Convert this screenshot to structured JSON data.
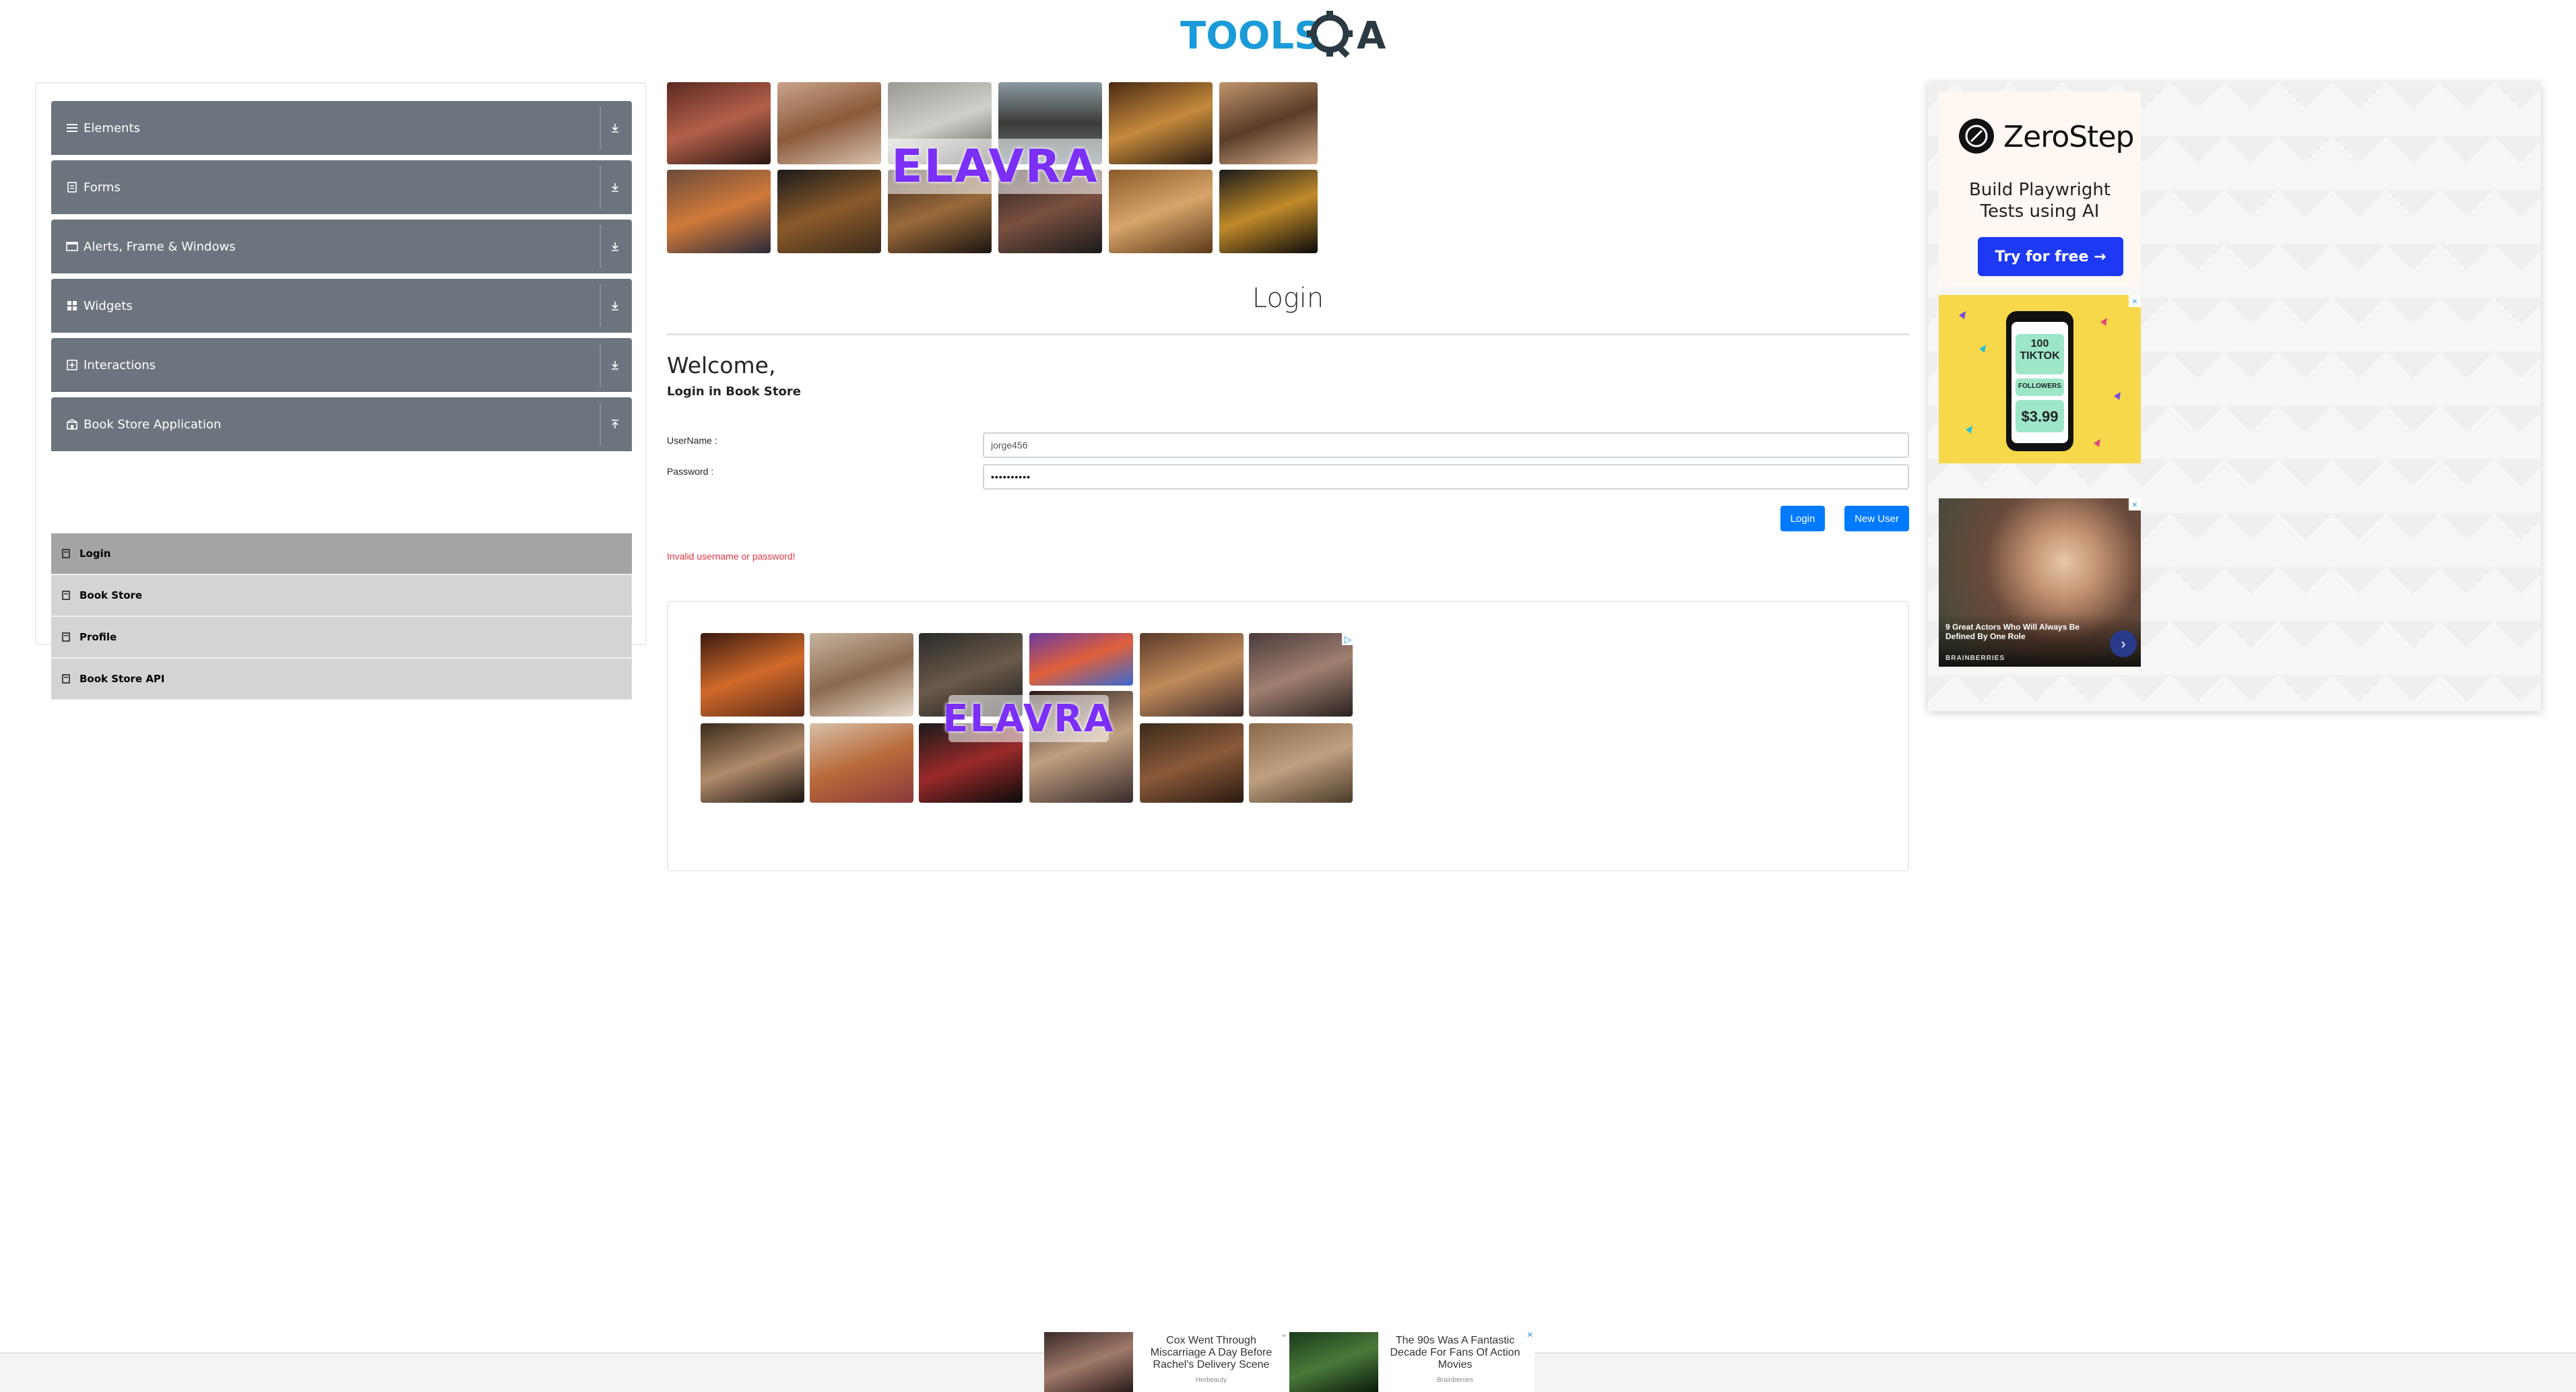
{
  "header": {
    "logo_alt": "TOOLSQA",
    "logo_left": "TOOLS",
    "logo_right": "A"
  },
  "sidebar": {
    "groups": [
      {
        "label": "Elements",
        "icon": "list-icon"
      },
      {
        "label": "Forms",
        "icon": "form-icon"
      },
      {
        "label": "Alerts, Frame & Windows",
        "icon": "window-icon"
      },
      {
        "label": "Widgets",
        "icon": "grid-icon"
      },
      {
        "label": "Interactions",
        "icon": "interaction-icon"
      },
      {
        "label": "Book Store Application",
        "icon": "bookstore-icon",
        "expanded": true
      }
    ],
    "items": [
      {
        "label": "Login",
        "active": true
      },
      {
        "label": "Book Store"
      },
      {
        "label": "Profile"
      },
      {
        "label": "Book Store API"
      }
    ]
  },
  "main": {
    "title": "Login",
    "welcome": "Welcome,",
    "subtitle": "Login in Book Store",
    "username_label": "UserName :",
    "username_value": "jorge456",
    "password_label": "Password :",
    "password_value": "••••••••••",
    "login_button": "Login",
    "new_user_button": "New User",
    "error": "Invalid username or password!"
  },
  "ads": {
    "brand_word": "ELAVRA",
    "zerostep": {
      "name": "ZeroStep",
      "tagline_1": "Build Playwright",
      "tagline_2": "Tests using AI",
      "cta": "Try for free →"
    },
    "tiktok": {
      "count": "100",
      "app": "TIKTOK",
      "unit": "FOLLOWERS",
      "price": "$3.99"
    },
    "celeb": {
      "headline": "9 Great Actors Who Will Always Be Defined By One Role",
      "source": "BRAINBERRIES"
    },
    "footer": [
      {
        "headline": "Cox Went Through Miscarriage A Day Before Rachel's Delivery Scene",
        "source": "Herbeauty"
      },
      {
        "headline": "The 90s Was A Fantastic Decade For Fans Of Action Movies",
        "source": "Brainberries"
      }
    ],
    "close_symbol": "×"
  },
  "colors": {
    "menu_header": "#6c757d",
    "menu_item": "#d4d4d4",
    "menu_item_active": "#a4a4a4",
    "primary": "#007bff",
    "error": "#dc3545",
    "logo_blue": "#1a9bd7",
    "logo_dark": "#2b3a42"
  }
}
